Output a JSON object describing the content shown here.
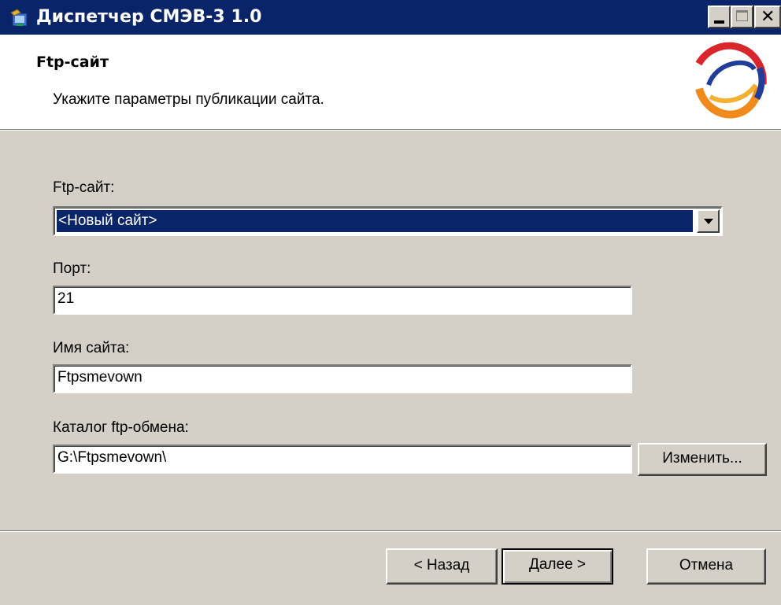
{
  "window": {
    "title": "Диспетчер СМЭВ-3 1.0",
    "titlebar_color": "#0a246a",
    "icon": "installer-icon"
  },
  "header": {
    "title": "Ftp-сайт",
    "description": "Укажите параметры публикации сайта.",
    "logo": "smev-logo"
  },
  "form": {
    "site_label": "Ftp-сайт:",
    "site_selected": "<Новый сайт>",
    "port_label": "Порт:",
    "port_value": "21",
    "name_label": "Имя сайта:",
    "name_value": "Ftpsmevown",
    "dir_label": "Каталог ftp-обмена:",
    "dir_value": "G:\\Ftpsmevown\\",
    "change_button": "Изменить..."
  },
  "footer": {
    "back_button": "< Назад",
    "next_button": "Далее >",
    "cancel_button": "Отмена"
  },
  "colors": {
    "dialog_face": "#d4d0c8",
    "selection": "#0a246a",
    "logo_blue": "#1f3d99",
    "logo_orange": "#f08a1c",
    "logo_red": "#d9262c"
  }
}
